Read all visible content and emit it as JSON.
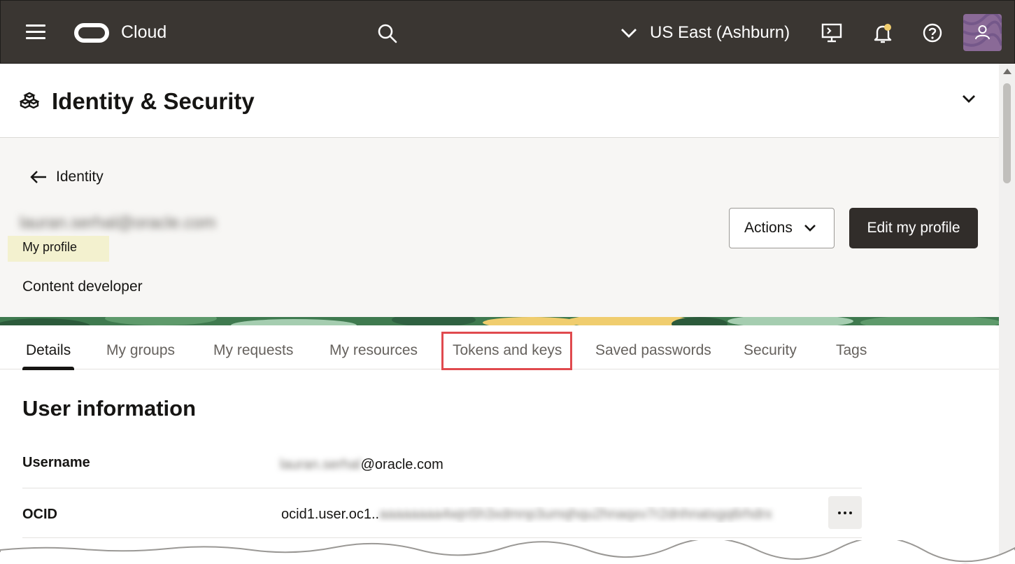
{
  "topbar": {
    "brand": "Cloud",
    "region": "US East (Ashburn)"
  },
  "header": {
    "title": "Identity & Security"
  },
  "profile": {
    "back_label": "Identity",
    "email_redacted": "lauran.serhal@oracle.com",
    "badge": "My profile",
    "role": "Content developer",
    "actions_label": "Actions",
    "edit_label": "Edit my profile"
  },
  "tabs": [
    {
      "label": "Details",
      "active": true
    },
    {
      "label": "My groups"
    },
    {
      "label": "My requests"
    },
    {
      "label": "My resources"
    },
    {
      "label": "Tokens and keys",
      "highlighted": true
    },
    {
      "label": "Saved passwords"
    },
    {
      "label": "Security"
    },
    {
      "label": "Tags"
    }
  ],
  "user_info": {
    "title": "User information",
    "username_label": "Username",
    "username_blur": "lauran.serhal",
    "username_domain": "@oracle.com",
    "ocid_label": "OCID",
    "ocid_prefix": "ocid1.user.oc1..",
    "ocid_blur": "aaaaaaaa4wjn5h3xdmnp3umqhqu2hnaqxv7r2dnhnatxgq6rhdrx"
  },
  "colors": {
    "topbar": "#3a3632",
    "highlight": "#e04a4e",
    "badge_bg": "#f3f1cf",
    "primary_button": "#312d2a"
  },
  "icons": [
    "menu-icon",
    "oracle-logo",
    "search-icon",
    "chevron-down-icon",
    "cloud-shell-icon",
    "bell-icon",
    "help-icon",
    "avatar",
    "boxes-icon",
    "arrow-left-icon",
    "more-icon"
  ]
}
